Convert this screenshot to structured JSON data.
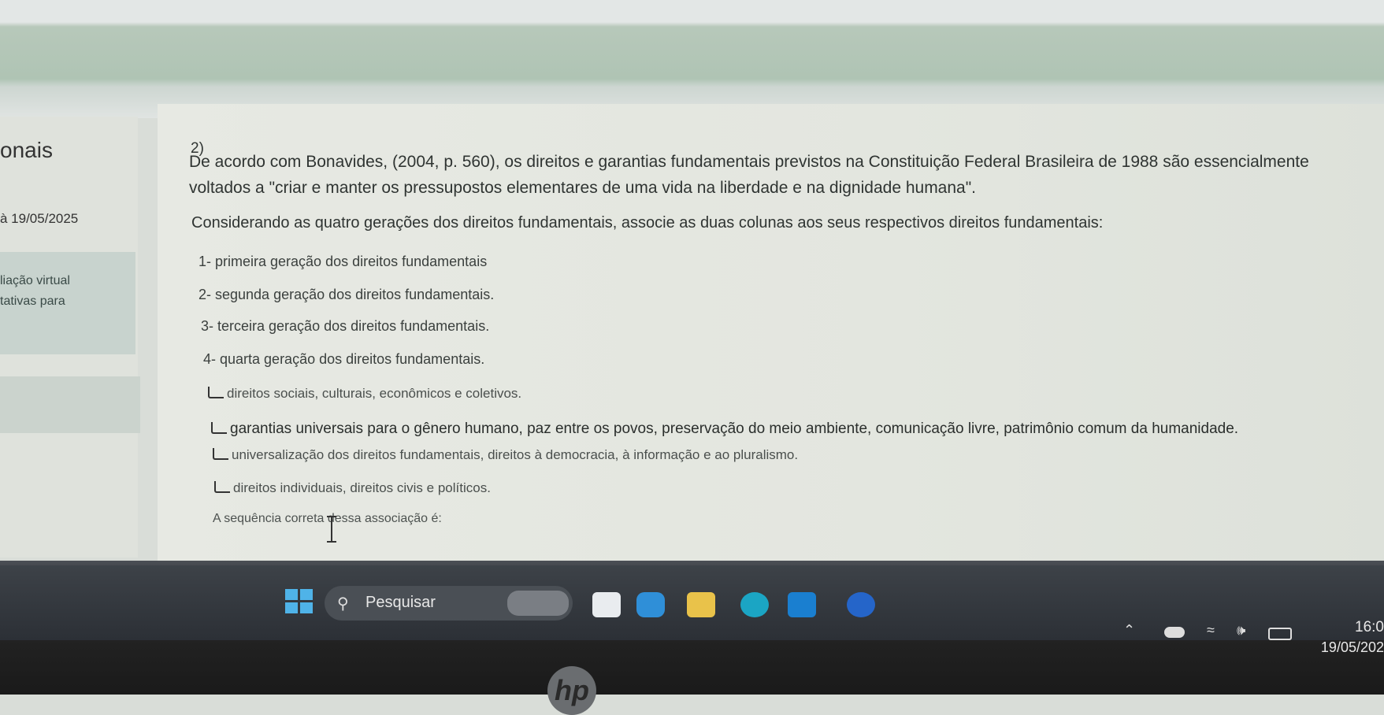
{
  "sidebar": {
    "title_fragment": "onais",
    "date_fragment": "à 19/05/2025",
    "card_line1": "liação virtual",
    "card_line2": "tativas para"
  },
  "question": {
    "number": "2)",
    "para1": "De acordo com Bonavides, (2004, p. 560), os direitos e garantias fundamentais previstos na Constituição Federal Brasileira de 1988 são essencialmente",
    "para2": "voltados a \"criar e manter os pressupostos elementares de uma vida na liberdade e na dignidade humana\".",
    "para3": "Considerando as quatro gerações dos direitos fundamentais, associe as duas colunas aos seus respectivos direitos fundamentais:",
    "generations": [
      "1- primeira geração dos direitos fundamentais",
      "2- segunda geração dos direitos fundamentais.",
      "3- terceira geração dos direitos fundamentais.",
      "4- quarta geração dos direitos fundamentais."
    ],
    "options": [
      "direitos sociais, culturais, econômicos e coletivos.",
      "garantias universais para o gênero humano, paz entre os povos, preservação do meio ambiente, comunicação livre, patrimônio comum da humanidade.",
      "universalização dos direitos fundamentais, direitos à democracia, à informação e ao pluralismo.",
      "direitos individuais, direitos civis e políticos."
    ],
    "sequence_prompt": "A sequência correta dessa associação é:"
  },
  "taskbar": {
    "search_label": "Pesquisar",
    "clock_time": "16:0",
    "clock_date": "19/05/202",
    "accent": "#4fb3e8"
  },
  "brand": "hp"
}
